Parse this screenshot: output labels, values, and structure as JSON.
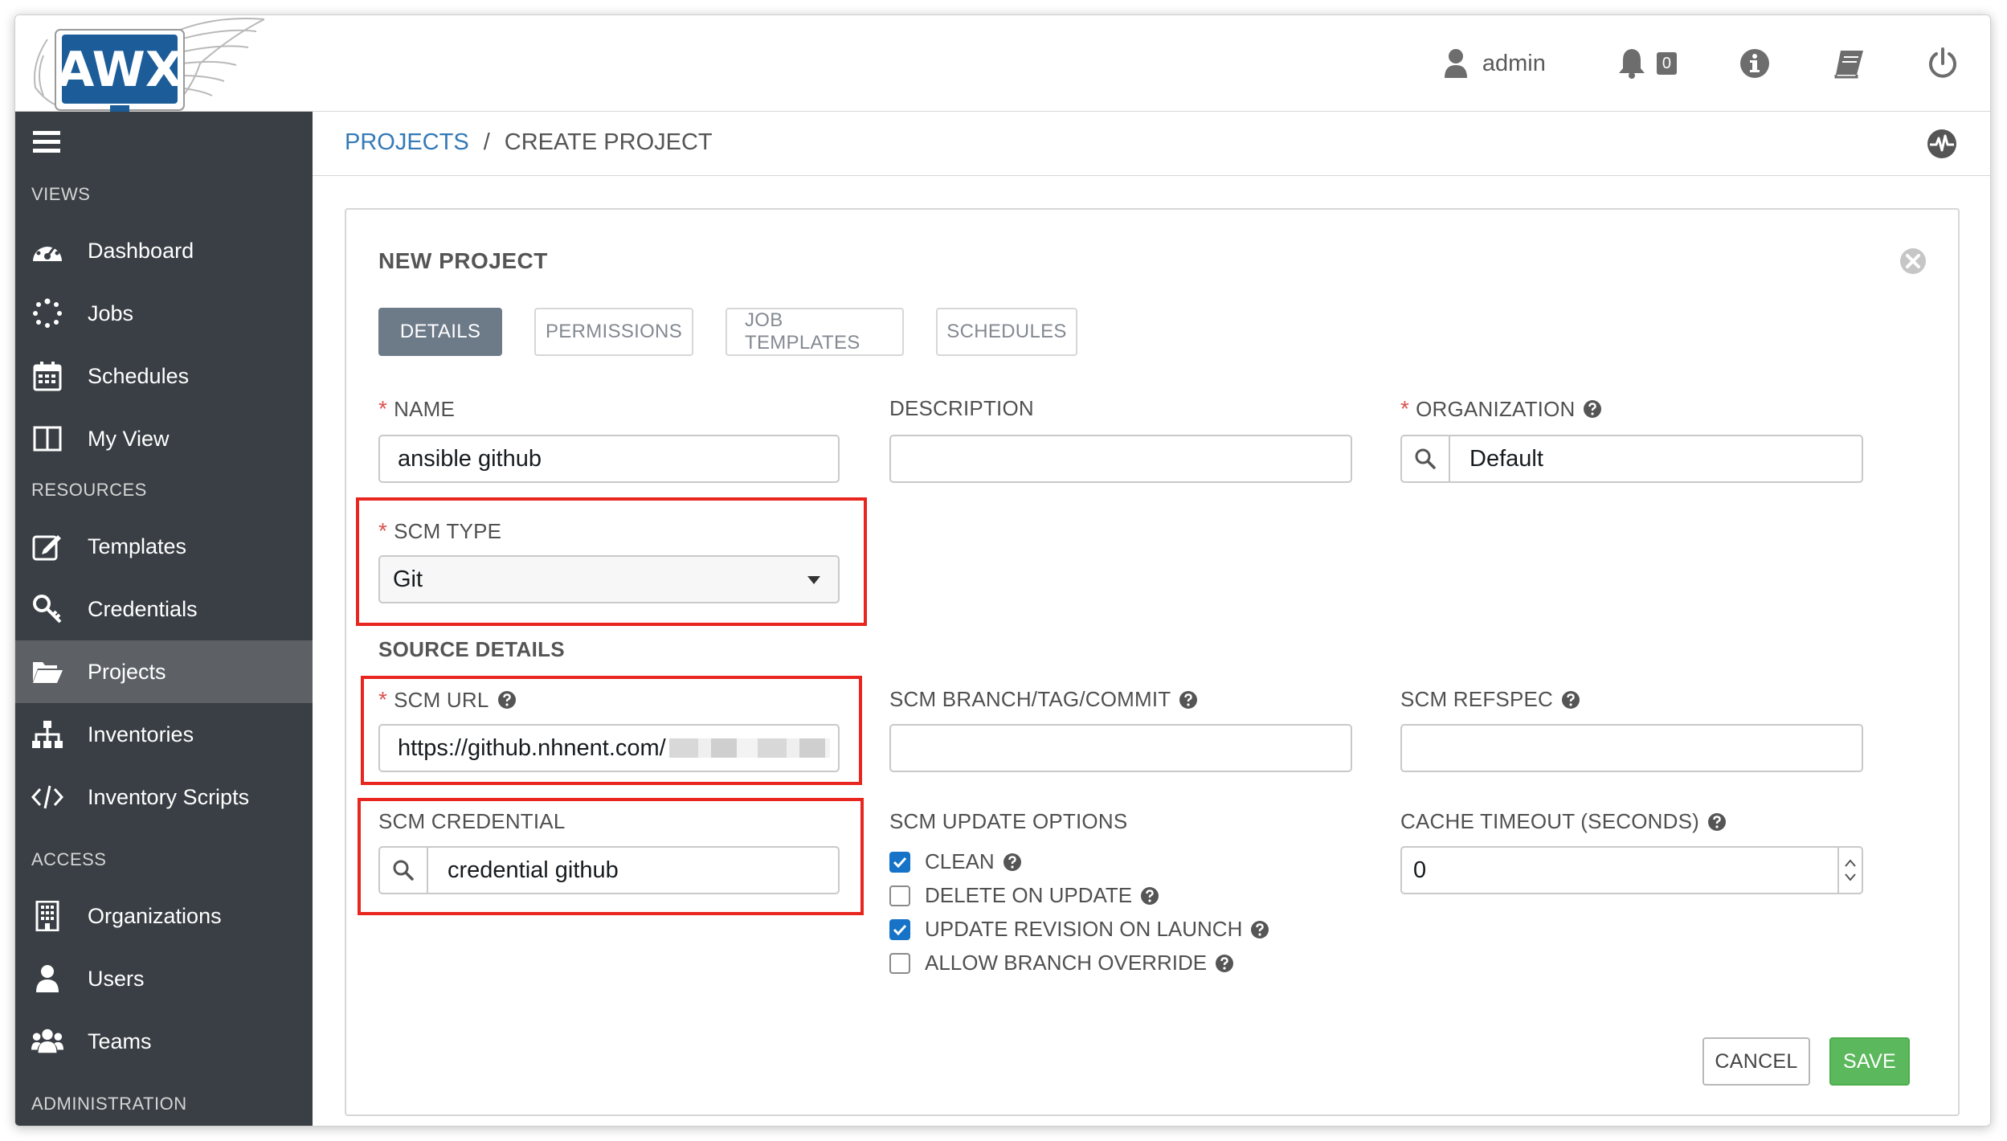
{
  "header": {
    "logo_text": "AWX",
    "user_name": "admin",
    "notification_count": "0",
    "icons": [
      "user-icon",
      "bell-icon",
      "info-icon",
      "book-icon",
      "power-icon"
    ]
  },
  "sidebar": {
    "sections": {
      "views": "VIEWS",
      "resources": "RESOURCES",
      "access": "ACCESS",
      "administration": "ADMINISTRATION"
    },
    "items": [
      {
        "label": "Dashboard",
        "icon": "dashboard-icon"
      },
      {
        "label": "Jobs",
        "icon": "spinner-icon"
      },
      {
        "label": "Schedules",
        "icon": "calendar-icon"
      },
      {
        "label": "My View",
        "icon": "columns-icon"
      },
      {
        "label": "Templates",
        "icon": "edit-icon"
      },
      {
        "label": "Credentials",
        "icon": "key-icon"
      },
      {
        "label": "Projects",
        "icon": "folder-open-icon",
        "active": true
      },
      {
        "label": "Inventories",
        "icon": "sitemap-icon"
      },
      {
        "label": "Inventory Scripts",
        "icon": "code-icon"
      },
      {
        "label": "Organizations",
        "icon": "building-icon"
      },
      {
        "label": "Users",
        "icon": "user-icon"
      },
      {
        "label": "Teams",
        "icon": "users-icon"
      }
    ]
  },
  "breadcrumb": {
    "parent": "PROJECTS",
    "separator": "/",
    "current": "CREATE PROJECT"
  },
  "form": {
    "title": "NEW PROJECT",
    "tabs": [
      "DETAILS",
      "PERMISSIONS",
      "JOB TEMPLATES",
      "SCHEDULES"
    ],
    "name": {
      "label": "NAME",
      "value": "ansible github"
    },
    "description": {
      "label": "DESCRIPTION",
      "value": ""
    },
    "organization": {
      "label": "ORGANIZATION",
      "value": "Default"
    },
    "scm_type": {
      "label": "SCM TYPE",
      "value": "Git"
    },
    "source_details": "SOURCE DETAILS",
    "scm_url": {
      "label": "SCM URL",
      "value": "https://github.nhnent.com/"
    },
    "scm_branch": {
      "label": "SCM BRANCH/TAG/COMMIT",
      "value": ""
    },
    "scm_refspec": {
      "label": "SCM REFSPEC",
      "value": ""
    },
    "scm_credential": {
      "label": "SCM CREDENTIAL",
      "value": "credential github"
    },
    "scm_update_options": {
      "label": "SCM UPDATE OPTIONS",
      "options": [
        {
          "label": "CLEAN",
          "checked": true
        },
        {
          "label": "DELETE ON UPDATE",
          "checked": false
        },
        {
          "label": "UPDATE REVISION ON LAUNCH",
          "checked": true
        },
        {
          "label": "ALLOW BRANCH OVERRIDE",
          "checked": false
        }
      ]
    },
    "cache_timeout": {
      "label": "CACHE TIMEOUT (SECONDS)",
      "value": "0"
    },
    "cancel_label": "CANCEL",
    "save_label": "SAVE"
  },
  "colors": {
    "sidebar_bg": "#393f44",
    "sidebar_active": "#5d6166",
    "link": "#337ab7",
    "highlight": "#e8261f",
    "save": "#5cb85c",
    "checkbox": "#1673c7"
  }
}
